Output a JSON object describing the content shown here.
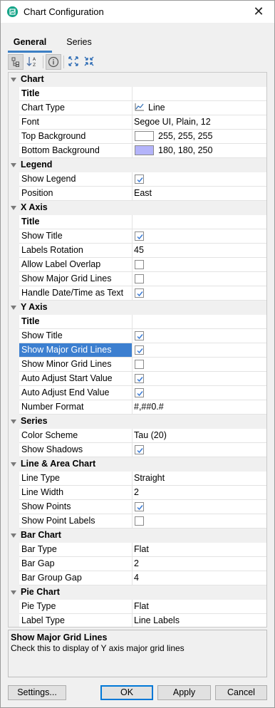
{
  "window": {
    "title": "Chart Configuration",
    "app_icon": "chart-icon",
    "close_glyph": "✕"
  },
  "tabs": [
    {
      "label": "General",
      "active": true
    },
    {
      "label": "Series",
      "active": false
    }
  ],
  "toolbar": [
    {
      "icon": "categorized-view-icon",
      "pressed": true
    },
    {
      "icon": "sort-alphabetical-icon",
      "pressed": false
    },
    {
      "icon": "info-icon",
      "pressed": true
    },
    {
      "icon": "expand-all-icon",
      "pressed": false
    },
    {
      "icon": "collapse-all-icon",
      "pressed": false
    }
  ],
  "properties": [
    {
      "kind": "category",
      "label": "Chart"
    },
    {
      "kind": "subheader",
      "label": "Title"
    },
    {
      "kind": "prop",
      "label": "Chart Type",
      "type": "chart-type",
      "value": "Line"
    },
    {
      "kind": "prop",
      "label": "Font",
      "type": "text",
      "value": "Segoe UI, Plain, 12"
    },
    {
      "kind": "prop",
      "label": "Top Background",
      "type": "color",
      "color": "#ffffff",
      "value": "255, 255, 255"
    },
    {
      "kind": "prop",
      "label": "Bottom Background",
      "type": "color",
      "color": "#b4b4fa",
      "value": "180, 180, 250"
    },
    {
      "kind": "category",
      "label": "Legend"
    },
    {
      "kind": "prop",
      "label": "Show Legend",
      "type": "bool",
      "checked": true
    },
    {
      "kind": "prop",
      "label": "Position",
      "type": "text",
      "value": "East"
    },
    {
      "kind": "category",
      "label": "X Axis"
    },
    {
      "kind": "subheader",
      "label": "Title"
    },
    {
      "kind": "prop",
      "label": "Show Title",
      "type": "bool",
      "checked": true
    },
    {
      "kind": "prop",
      "label": "Labels Rotation",
      "type": "text",
      "value": "45"
    },
    {
      "kind": "prop",
      "label": "Allow Label Overlap",
      "type": "bool",
      "checked": false
    },
    {
      "kind": "prop",
      "label": "Show Major Grid Lines",
      "type": "bool",
      "checked": false
    },
    {
      "kind": "prop",
      "label": "Handle Date/Time as Text",
      "type": "bool",
      "checked": true
    },
    {
      "kind": "category",
      "label": "Y Axis"
    },
    {
      "kind": "subheader",
      "label": "Title"
    },
    {
      "kind": "prop",
      "label": "Show Title",
      "type": "bool",
      "checked": true
    },
    {
      "kind": "prop",
      "label": "Show Major Grid Lines",
      "type": "bool",
      "checked": true,
      "selected": true
    },
    {
      "kind": "prop",
      "label": "Show Minor Grid Lines",
      "type": "bool",
      "checked": false
    },
    {
      "kind": "prop",
      "label": "Auto Adjust Start Value",
      "type": "bool",
      "checked": true
    },
    {
      "kind": "prop",
      "label": "Auto Adjust End Value",
      "type": "bool",
      "checked": true
    },
    {
      "kind": "prop",
      "label": "Number Format",
      "type": "text",
      "value": "#,##0.#"
    },
    {
      "kind": "category",
      "label": "Series"
    },
    {
      "kind": "prop",
      "label": "Color Scheme",
      "type": "text",
      "value": "Tau (20)"
    },
    {
      "kind": "prop",
      "label": "Show Shadows",
      "type": "bool",
      "checked": true
    },
    {
      "kind": "category",
      "label": "Line & Area Chart"
    },
    {
      "kind": "prop",
      "label": "Line Type",
      "type": "text",
      "value": "Straight"
    },
    {
      "kind": "prop",
      "label": "Line Width",
      "type": "text",
      "value": "2"
    },
    {
      "kind": "prop",
      "label": "Show Points",
      "type": "bool",
      "checked": true
    },
    {
      "kind": "prop",
      "label": "Show Point Labels",
      "type": "bool",
      "checked": false
    },
    {
      "kind": "category",
      "label": "Bar Chart"
    },
    {
      "kind": "prop",
      "label": "Bar Type",
      "type": "text",
      "value": "Flat"
    },
    {
      "kind": "prop",
      "label": "Bar Gap",
      "type": "text",
      "value": "2"
    },
    {
      "kind": "prop",
      "label": "Bar Group Gap",
      "type": "text",
      "value": "4"
    },
    {
      "kind": "category",
      "label": "Pie Chart"
    },
    {
      "kind": "prop",
      "label": "Pie Type",
      "type": "text",
      "value": "Flat"
    },
    {
      "kind": "prop",
      "label": "Label Type",
      "type": "text",
      "value": "Line Labels"
    }
  ],
  "description": {
    "title": "Show Major Grid Lines",
    "text": "Check this to display of Y axis major grid lines"
  },
  "buttons": {
    "settings": "Settings...",
    "ok": "OK",
    "apply": "Apply",
    "cancel": "Cancel"
  },
  "colors": {
    "selection": "#3c7fd0",
    "tab_underline": "#3c7fc4",
    "check": "#3b7bd4"
  }
}
